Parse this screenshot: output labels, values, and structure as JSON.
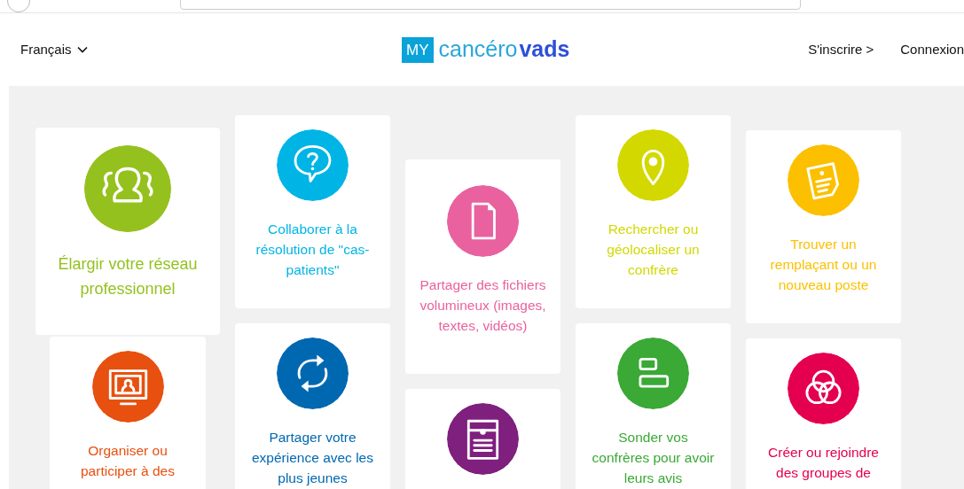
{
  "header": {
    "language": "Français",
    "logo": {
      "badge": "MY",
      "word_1": "cancéro",
      "word_2": "vads"
    },
    "links": [
      "S'inscrire >",
      "Connexion"
    ]
  },
  "columns": [
    {
      "cards": [
        {
          "kind": "people",
          "color": "#95c11f",
          "text": "Élargir votre réseau professionnel"
        },
        {
          "kind": "webcam",
          "color": "#e8500f",
          "text": "Organiser ou participer à des"
        }
      ]
    },
    {
      "cards": [
        {
          "kind": "question",
          "color": "#00b5e5",
          "text": "Collaborer à la résolution de \"cas-patients\""
        },
        {
          "kind": "sync",
          "color": "#0068b1",
          "text": "Partager votre expérience avec les plus jeunes"
        }
      ]
    },
    {
      "cards": [
        {
          "kind": "file",
          "color": "#e9629f",
          "text": "Partager des fichiers volumineux (images, textes, vidéos)"
        },
        {
          "kind": "profile",
          "color": "#7f1f7e"
        }
      ]
    },
    {
      "cards": [
        {
          "kind": "pin",
          "color": "#d3d800",
          "text": "Rechercher ou géolocaliser un confrère"
        },
        {
          "kind": "poll",
          "color": "#3aa935",
          "text": "Sonder vos confrères pour avoir leurs avis"
        }
      ]
    },
    {
      "cards": [
        {
          "kind": "resume",
          "color": "#fcc000",
          "text": "Trouver un remplaçant ou un nouveau poste"
        },
        {
          "kind": "circles",
          "color": "#e4004f",
          "text": "Créer ou rejoindre des groupes de"
        }
      ]
    }
  ]
}
